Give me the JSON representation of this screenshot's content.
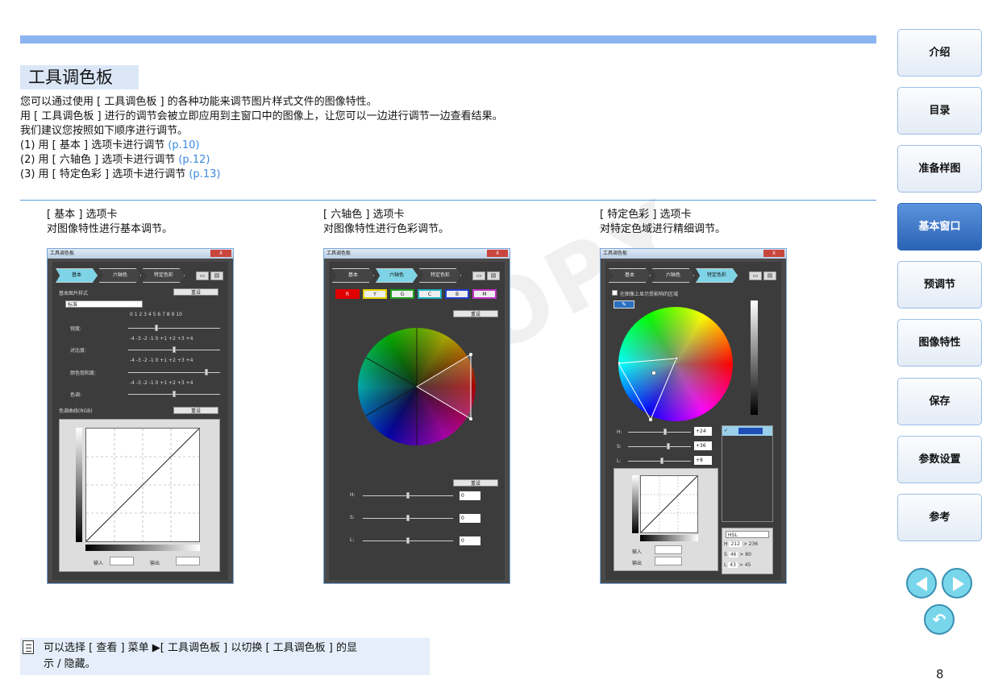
{
  "section_title": "工具调色板",
  "intro_lines": [
    "您可以通过使用 [ 工具调色板 ] 的各种功能来调节图片样式文件的图像特性。",
    "用 [ 工具调色板 ] 进行的调节会被立即应用到主窗口中的图像上，让您可以一边进行调节一边查看结果。",
    "我们建议您按照如下顺序进行调节。"
  ],
  "steps": [
    {
      "text": "(1) 用 [ 基本 ] 选项卡进行调节 ",
      "link": "(p.10)"
    },
    {
      "text": "(2) 用 [ 六轴色 ] 选项卡进行调节 ",
      "link": "(p.12)"
    },
    {
      "text": "(3) 用 [ 特定色彩 ] 选项卡进行调节 ",
      "link": "(p.13)"
    }
  ],
  "panels": [
    {
      "caption1": "[ 基本 ] 选项卡",
      "caption2": "对图像特性进行基本调节。"
    },
    {
      "caption1": "[ 六轴色 ] 选项卡",
      "caption2": "对图像特性进行色彩调节。"
    },
    {
      "caption1": "[ 特定色彩 ] 选项卡",
      "caption2": "对特定色域进行精细调节。"
    }
  ],
  "window": {
    "title": "工具调色板",
    "close": "X",
    "tabs": [
      "基本",
      "六轴色",
      "特定色彩"
    ],
    "reset": "重设",
    "basic": {
      "style_label": "基本图片样式",
      "style_value": "标准",
      "scale_top": "0 1 2 3 4 5 6 7 8 9 10",
      "scale": "-4 -3 -2 -1 0 +1 +2 +3 +4",
      "sharpness": "锐度:",
      "contrast": "对比度:",
      "saturation": "颜色饱和度:",
      "hue": "色调:",
      "curve_label": "色调曲线(RGB)",
      "input": "输入",
      "output": "输出"
    },
    "sixaxis": {
      "colors": [
        {
          "label": "R",
          "color": "#e00000"
        },
        {
          "label": "Y",
          "color": "#e0d000"
        },
        {
          "label": "G",
          "color": "#20a020"
        },
        {
          "label": "C",
          "color": "#20b0c0"
        },
        {
          "label": "B",
          "color": "#2040d0"
        },
        {
          "label": "M",
          "color": "#c030c0"
        }
      ],
      "h": "H:",
      "s": "S:",
      "l": "L:",
      "h_val": "0",
      "s_val": "0",
      "l_val": "0"
    },
    "specific": {
      "show_area": "在图像上显示受影响的区域",
      "h": "H:",
      "s": "S:",
      "l": "L:",
      "h_val": "+24",
      "s_val": "+36",
      "l_val": "+8",
      "mode": "HSL",
      "rows": [
        {
          "k": "H",
          "a": "212",
          "b": "236"
        },
        {
          "k": "S",
          "a": "46",
          "b": "80"
        },
        {
          "k": "L",
          "a": "43",
          "b": "45"
        }
      ],
      "arrow": ">",
      "check": "✓",
      "input": "输入",
      "output": "输出"
    }
  },
  "nav": [
    "介绍",
    "目录",
    "准备样图",
    "基本窗口",
    "预调节",
    "图像特性",
    "保存",
    "参数设置",
    "参考"
  ],
  "nav_active": "基本窗口",
  "note": {
    "line1": "可以选择 [ 查看 ] 菜单 ▶[ 工具调色板 ] 以切换 [ 工具调色板 ] 的显",
    "line2": "示 / 隐藏。"
  },
  "watermark": "COPY",
  "page_number": "8"
}
